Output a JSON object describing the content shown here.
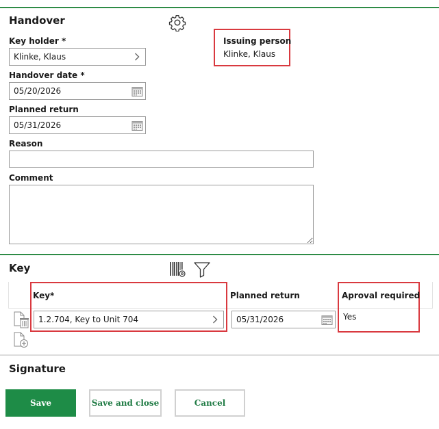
{
  "handover": {
    "title": "Handover",
    "key_holder_label": "Key holder *",
    "key_holder_value": "Klinke, Klaus",
    "handover_date_label": "Handover date *",
    "handover_date_value": "05/20/2026",
    "planned_return_label": "Planned return",
    "planned_return_value": "05/31/2026",
    "reason_label": "Reason",
    "reason_value": "",
    "comment_label": "Comment",
    "comment_value": "",
    "issuing_person_label": "Issuing person",
    "issuing_person_value": "Klinke, Klaus"
  },
  "key_section": {
    "title": "Key",
    "columns": {
      "key": "Key*",
      "planned_return": "Planned return",
      "approval_required": "Aproval required"
    },
    "rows": [
      {
        "key": "1.2.704, Key to Unit 704",
        "planned_return": "05/31/2026",
        "approval_required": "Yes"
      }
    ]
  },
  "signature": {
    "title": "Signature"
  },
  "buttons": {
    "save": "Save",
    "save_and_close": "Save and close",
    "cancel": "Cancel"
  },
  "colors": {
    "accent_green": "#1e8c47",
    "highlight_red": "#d9393f"
  }
}
